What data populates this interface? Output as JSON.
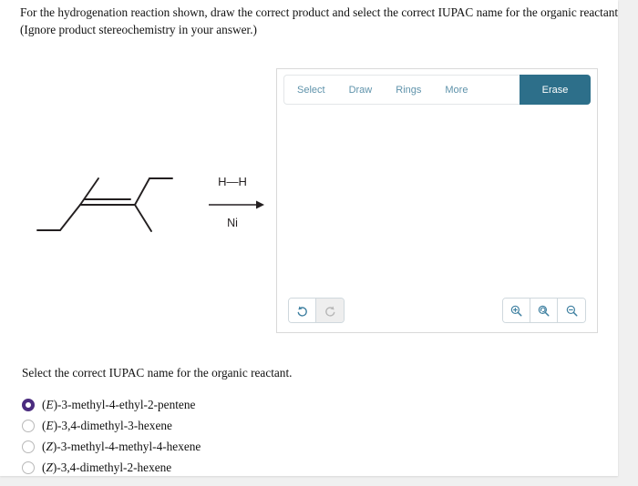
{
  "prompt": {
    "line1": "For the hydrogenation reaction shown, draw the correct product and select the correct IUPAC name for the organic reactant.",
    "line2": "(Ignore product stereochemistry in your answer.)"
  },
  "scheme": {
    "reagent_above": "H—H",
    "reagent_below": "Ni",
    "reactant_description": "skeletal structure of 3,4-dimethyl-3-hexene (tetrasubstituted alkene, E configuration)"
  },
  "sketcher": {
    "tabs": [
      {
        "label": "Select"
      },
      {
        "label": "Draw"
      },
      {
        "label": "Rings"
      },
      {
        "label": "More"
      }
    ],
    "erase_label": "Erase",
    "accent_color": "#2d6f8a",
    "tab_text_color": "#5f93ab",
    "history_buttons": [
      {
        "name": "undo",
        "enabled": true
      },
      {
        "name": "redo",
        "enabled": false
      }
    ],
    "zoom_buttons": [
      {
        "name": "zoom-in"
      },
      {
        "name": "zoom-reset"
      },
      {
        "name": "zoom-out"
      }
    ]
  },
  "question": {
    "text": "Select the correct IUPAC name for the organic reactant.",
    "selected_index": 0,
    "selected_color": "#4b2c7f",
    "options": [
      {
        "prefix": "E",
        "rest": ")-3-methyl-4-ethyl-2-pentene",
        "selected": true
      },
      {
        "prefix": "E",
        "rest": ")-3,4-dimethyl-3-hexene",
        "selected": false
      },
      {
        "prefix": "Z",
        "rest": ")-3-methyl-4-methyl-4-hexene",
        "selected": false
      },
      {
        "prefix": "Z",
        "rest": ")-3,4-dimethyl-2-hexene",
        "selected": false
      }
    ]
  }
}
